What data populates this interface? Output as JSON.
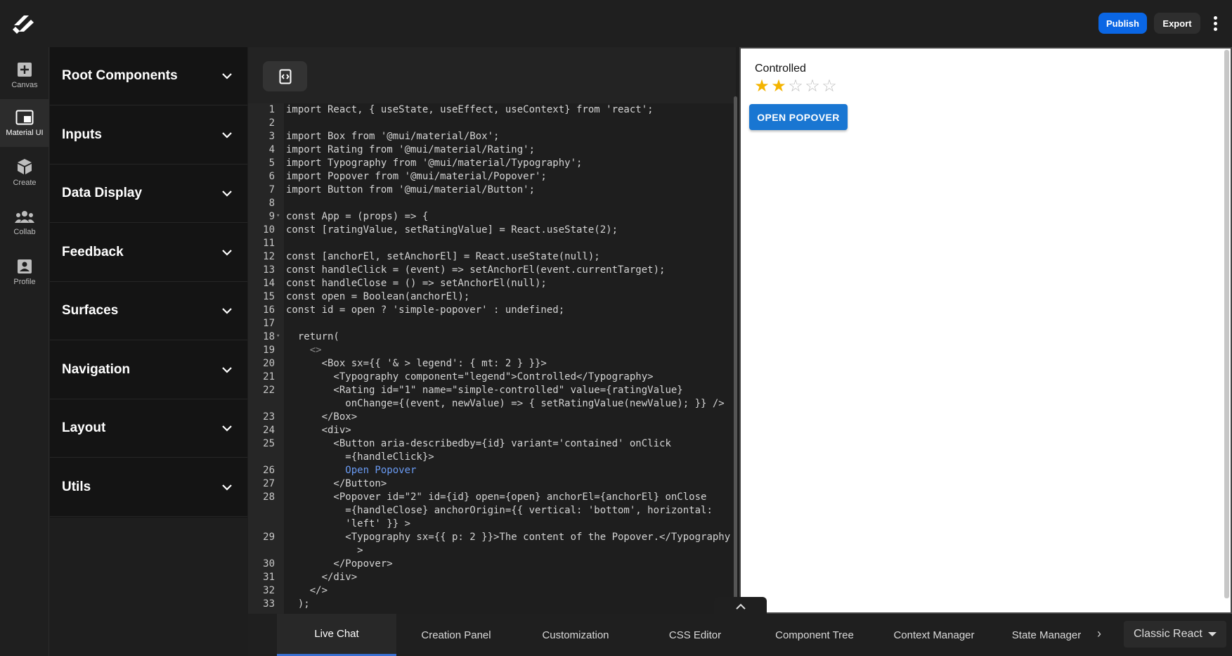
{
  "topbar": {
    "publish_label": "Publish",
    "export_label": "Export"
  },
  "rail": [
    {
      "label": "Canvas",
      "icon": "plus-square-icon"
    },
    {
      "label": "Material UI",
      "icon": "window-icon"
    },
    {
      "label": "Create",
      "icon": "cube-icon"
    },
    {
      "label": "Collab",
      "icon": "group-icon"
    },
    {
      "label": "Profile",
      "icon": "profile-icon"
    }
  ],
  "sidebar": {
    "sections": [
      "Root Components",
      "Inputs",
      "Data Display",
      "Feedback",
      "Surfaces",
      "Navigation",
      "Layout",
      "Utils"
    ]
  },
  "editor": {
    "line_numbers": [
      "1",
      "2",
      "3",
      "4",
      "5",
      "6",
      "7",
      "8",
      "9",
      "10",
      "11",
      "12",
      "13",
      "14",
      "15",
      "16",
      "17",
      "18",
      "19",
      "20",
      "21",
      "22",
      "23",
      "24",
      "25",
      "26",
      "27",
      "28",
      "29",
      "30",
      "31",
      "32",
      "33"
    ],
    "lines": [
      "import React, { useState, useEffect, useContext} from 'react';",
      "",
      "import Box from '@mui/material/Box';",
      "import Rating from '@mui/material/Rating';",
      "import Typography from '@mui/material/Typography';",
      "import Popover from '@mui/material/Popover';",
      "import Button from '@mui/material/Button';",
      "",
      "const App = (props) => {",
      "const [ratingValue, setRatingValue] = React.useState(2);",
      "",
      "const [anchorEl, setAnchorEl] = React.useState(null);",
      "const handleClick = (event) => setAnchorEl(event.currentTarget);",
      "const handleClose = () => setAnchorEl(null);",
      "const open = Boolean(anchorEl);",
      "const id = open ? 'simple-popover' : undefined;",
      "",
      "  return(",
      "    <>",
      "      <Box sx={{ '& > legend': { mt: 2 } }}>",
      "        <Typography component=\"legend\">Controlled</Typography>",
      "        <Rating id=\"1\" name=\"simple-controlled\" value={ratingValue}",
      "          onChange={(event, newValue) => { setRatingValue(newValue); }} />",
      "      </Box>",
      "      <div>",
      "        <Button aria-describedby={id} variant='contained' onClick",
      "          ={handleClick}>",
      "          Open Popover",
      "        </Button>",
      "        <Popover id=\"2\" id={id} open={open} anchorEl={anchorEl} onClose",
      "          ={handleClose} anchorOrigin={{ vertical: 'bottom', horizontal:",
      "          'left' }} >",
      "          <Typography sx={{ p: 2 }}>The content of the Popover.</Typography",
      "            >",
      "        </Popover>",
      "      </div>",
      "    </>",
      "  );"
    ]
  },
  "preview": {
    "label": "Controlled",
    "rating": {
      "value": 2,
      "max": 5
    },
    "button_label": "OPEN POPOVER"
  },
  "bottom": {
    "tabs": [
      "Live Chat",
      "Creation Panel",
      "Customization",
      "CSS Editor",
      "Component Tree",
      "Context Manager",
      "State Manager"
    ],
    "active_tab": "Live Chat",
    "stack_value": "Classic React"
  }
}
